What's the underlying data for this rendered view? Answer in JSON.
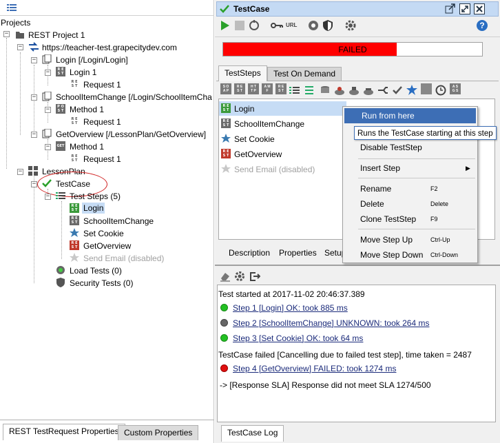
{
  "navigator": {
    "title": "Projects",
    "tree": {
      "project": "REST Project 1",
      "service": "https://teacher-test.grapecitydev.com",
      "resources": [
        {
          "label": "Login [/Login/Login]",
          "method": "Login 1",
          "request": "Request 1"
        },
        {
          "label": "SchoolItemChange [/Login/SchoolItemCha",
          "method": "Method 1",
          "request": "Request 1"
        },
        {
          "label": "GetOverview [/LessonPlan/GetOverview]",
          "method": "Method 1",
          "request": "Request 1"
        }
      ],
      "suite": "LessonPlan",
      "testcase": "TestCase",
      "test_steps": "Test Steps (5)",
      "steps": [
        "Login",
        "SchoolItemChange",
        "Set Cookie",
        "GetOverview",
        "Send Email (disabled)"
      ],
      "load_tests": "Load Tests (0)",
      "security_tests": "Security Tests (0)"
    },
    "bottom_tabs": [
      "REST TestRequest Properties",
      "Custom Properties"
    ]
  },
  "editor": {
    "title": "TestCase",
    "status": "FAILED",
    "progress": 0.67,
    "toolbar_url": "URL",
    "tabs": [
      "TestSteps",
      "Test On Demand"
    ],
    "steps": [
      "Login",
      "SchoolItemChange",
      "Set Cookie",
      "GetOverview",
      "Send Email (disabled)"
    ],
    "subtabs": [
      "Description",
      "Properties",
      "Setup"
    ],
    "log": {
      "started": "Test started at 2017-11-02 20:46:37.389",
      "lines": [
        {
          "text": "Step 1 [Login] OK: took 885 ms",
          "status": "ok"
        },
        {
          "text": "Step 2 [SchoolItemChange] UNKNOWN: took 264 ms",
          "status": "unknown"
        },
        {
          "text": "Step 3 [Set Cookie] OK: took 64 ms",
          "status": "ok"
        }
      ],
      "failed_msg": "TestCase failed [Cancelling due to failed test step], time taken = 2487",
      "failed_step": "Step 4 [GetOverview] FAILED: took 1274 ms",
      "sla": "-> [Response SLA] Response did not meet SLA 1274/500"
    },
    "log_tab": "TestCase Log"
  },
  "context_menu": {
    "items": [
      {
        "label": "Run from here",
        "shortcut": ""
      },
      {
        "label": "Disable TestStep",
        "shortcut": ""
      },
      {
        "label": "Insert Step",
        "shortcut": ""
      },
      {
        "label": "Rename",
        "shortcut": "F2"
      },
      {
        "label": "Delete",
        "shortcut": "Delete"
      },
      {
        "label": "Clone TestStep",
        "shortcut": "F9"
      },
      {
        "label": "Move Step Up",
        "shortcut": "Ctrl-Up"
      },
      {
        "label": "Move Step Down",
        "shortcut": "Ctrl-Down"
      }
    ],
    "tooltip": "Runs the TestCase starting at this step"
  },
  "colors": {
    "accent": "#3d6eb5",
    "failed": "#ff0000",
    "selected": "#c6dcf5",
    "ok": "#22c022",
    "fail_dot": "#e01010"
  }
}
